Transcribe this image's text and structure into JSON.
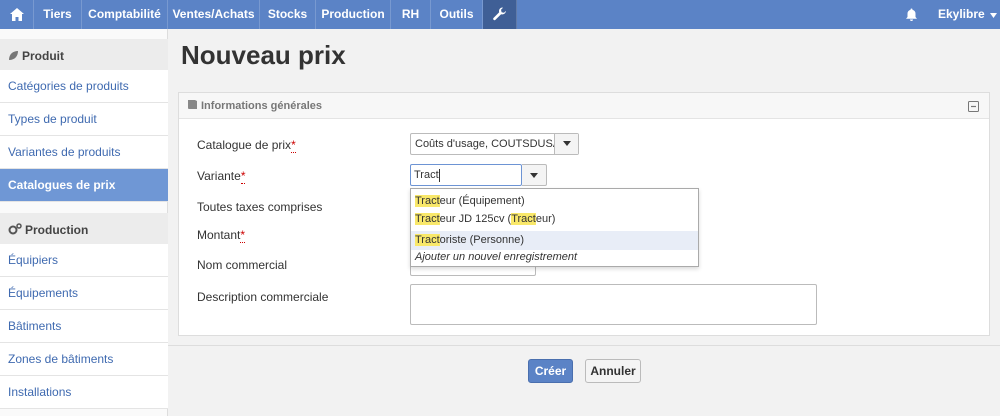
{
  "topbar": {
    "items": [
      "Tiers",
      "Comptabilité",
      "Ventes/Achats",
      "Stocks",
      "Production",
      "RH",
      "Outils"
    ],
    "user": "Ekylibre"
  },
  "sidebar": {
    "sections": [
      {
        "title": "Produit",
        "items": [
          "Catégories de produits",
          "Types de produit",
          "Variantes de produits",
          "Catalogues de prix"
        ]
      },
      {
        "title": "Production",
        "items": [
          "Équipiers",
          "Équipements",
          "Bâtiments",
          "Zones de bâtiments",
          "Installations"
        ]
      }
    ]
  },
  "page": {
    "title": "Nouveau prix"
  },
  "panel": {
    "title": "Informations générales",
    "labels": {
      "catalogue": "Catalogue de prix",
      "variante": "Variante",
      "ttc": "Toutes taxes comprises",
      "montant": "Montant",
      "nom": "Nom commercial",
      "description": "Description commerciale"
    },
    "catalogue_value": "Coûts d'usage, COUTSDUSAG",
    "variante_value": "Tract"
  },
  "dropdown": {
    "items": [
      {
        "match1": "Tract",
        "rest1": "eur (Équipement)",
        "match2": "",
        "rest2": ""
      },
      {
        "match1": "Tract",
        "rest1": "eur JD 125cv (",
        "match2": "Tract",
        "rest2": "eur)"
      },
      {
        "match1": "Tract",
        "rest1": "oriste (Personne)",
        "match2": "",
        "rest2": ""
      }
    ],
    "add_new": "Ajouter un nouvel enregistrement"
  },
  "actions": {
    "create": "Créer",
    "cancel": "Annuler"
  },
  "colors": {
    "accent": "#5b83c6",
    "highlight": "#f9e86a",
    "active_sidebar": "#6f97d5"
  }
}
